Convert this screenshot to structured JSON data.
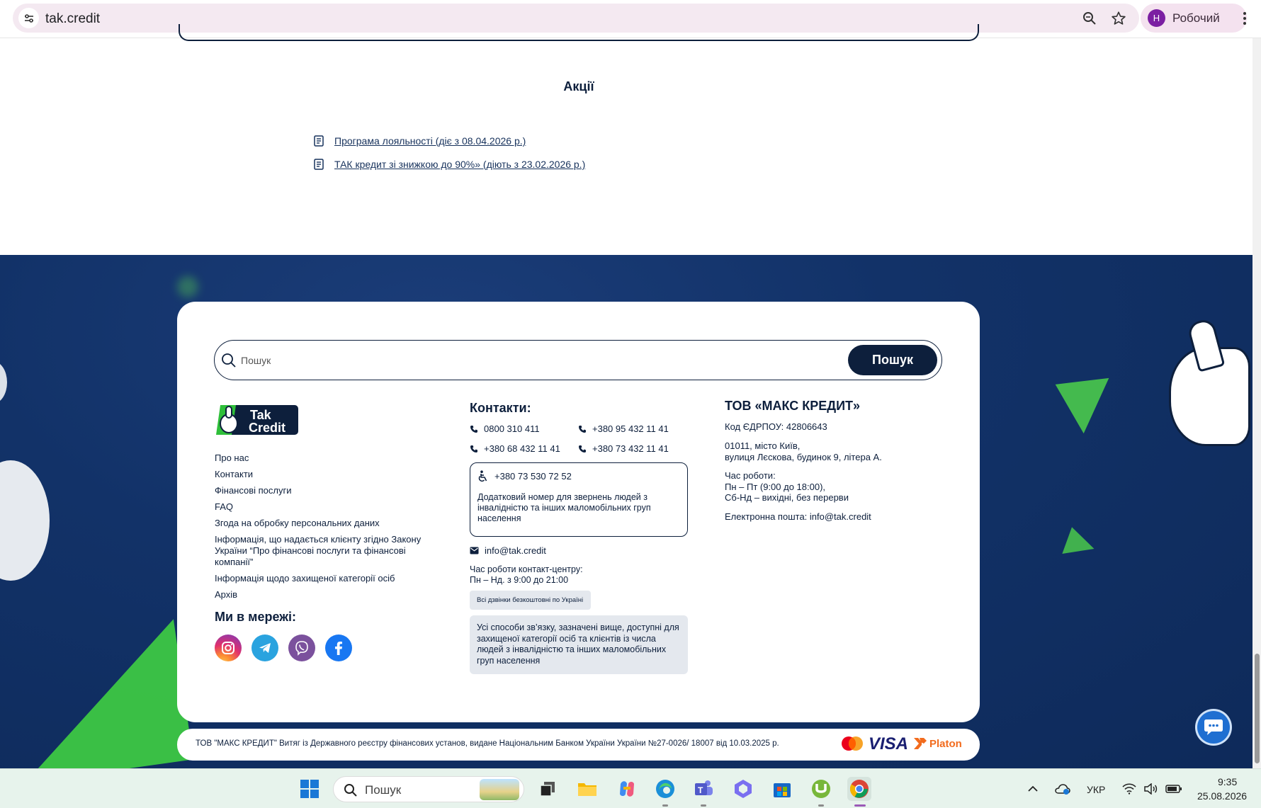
{
  "browser": {
    "url": "tak.credit",
    "profile_initial": "Н",
    "profile_name": "Робочий"
  },
  "promotions": {
    "title": "Акції",
    "links": [
      "Програма лояльності (діє з 08.04.2026 р.)",
      "ТАК кредит зі знижкою до 90%» (діють з 23.02.2026 р.)"
    ]
  },
  "search": {
    "placeholder": "Пошук",
    "button_label": "Пошук"
  },
  "logo": {
    "line1": "Tak",
    "line2": "Credit"
  },
  "nav": {
    "links": [
      "Про нас",
      "Контакти",
      "Фінансові послуги",
      "FAQ",
      "Згода на обробку персональних даних",
      "Інформація, що надається клієнту згідно Закону України “Про фінансові послуги та фінансові компанії”",
      "Інформація щодо захищеної категорії осіб",
      "Архів"
    ]
  },
  "social": {
    "title": "Ми в мережі:",
    "networks": [
      "instagram-icon",
      "telegram-icon",
      "viber-icon",
      "facebook-icon"
    ],
    "colors": {
      "instagram": "#e1306c",
      "telegram": "#2aa3df",
      "viber": "#7b519d",
      "facebook": "#1877f2"
    }
  },
  "contacts": {
    "title": "Контакти:",
    "phones": [
      "0800 310 411",
      "+380 95 432 11 41",
      "+380 68 432 11 41",
      "+380 73 432 11 41"
    ],
    "accessible_phone": "+380 73 530 72 52",
    "accessible_note": "Додатковий номер для звернень людей з інвалідністю та інших маломобільних груп населення",
    "email": "info@tak.credit",
    "hours_label": "Час роботи контакт-центру:",
    "hours": "Пн – Нд. з 9:00 до 21:00",
    "free_calls": "Всі дзвінки безкоштовні по Україні",
    "availability_note": "Усі способи зв’язку, зазначені вище, доступні для захищеної категорії осіб та клієнтів із числа людей з інвалідністю та інших маломобільних груп населення"
  },
  "company": {
    "title": "ТОВ «МАКС КРЕДИТ»",
    "edrpou": "Код ЄДРПОУ: 42806643",
    "address_line1": "01011, місто Київ,",
    "address_line2": "вулиця Лєскова, будинок 9, літера А.",
    "hours_label": "Час роботи:",
    "hours_weekdays": "Пн – Пт (9:00 до 18:00),",
    "hours_weekend": "Сб-Нд – вихідні, без перерви",
    "email": "Електронна пошта: info@tak.credit"
  },
  "legal": {
    "text": "ТОВ \"МАКС КРЕДИТ\" Витяг із Державного реєстру фінансових установ, видане Національним Банком України України №27-0026/ 18007 від 10.03.2025 р.",
    "payments": [
      "mastercard-icon",
      "VISA",
      "Platon"
    ]
  },
  "colors": {
    "navy": "#0d1f3c",
    "footer_blue": "#123268",
    "green_accent": "#5fdc4c"
  },
  "taskbar": {
    "search_placeholder": "Пошук",
    "language": "УКР",
    "time": "9:35",
    "date": "25.08.2026"
  }
}
